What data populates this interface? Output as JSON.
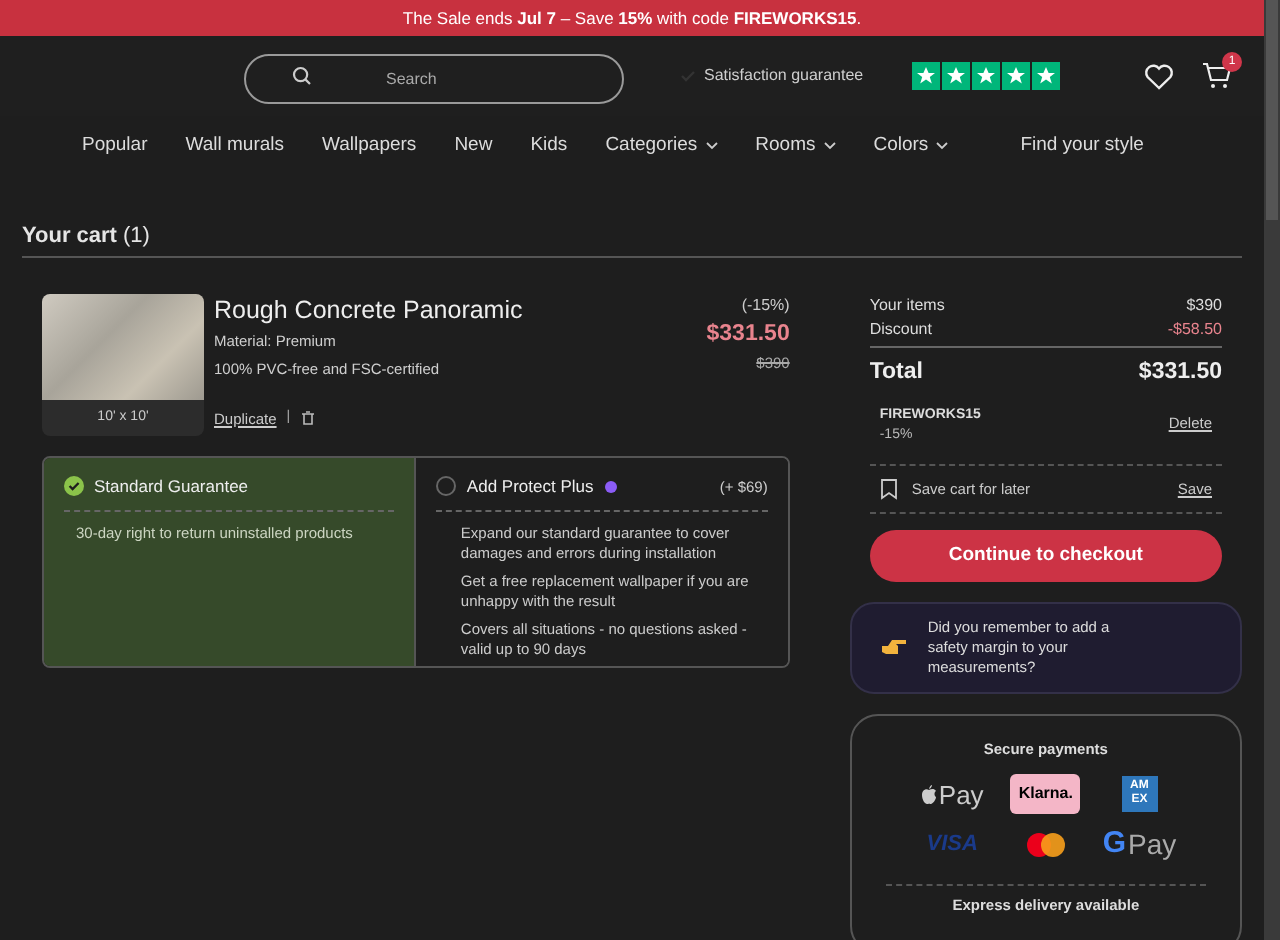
{
  "banner": {
    "text": "The Sale ends **Jul 7** – Save **15%** with code **FIREWORKS15**."
  },
  "header": {
    "search": {
      "placeholder": "Search"
    },
    "guarantee": "Satisfaction guarantee",
    "stars": 5,
    "cart_count": "1"
  },
  "nav": [
    {
      "label": "Popular",
      "dropdown": false
    },
    {
      "label": "Wall murals",
      "dropdown": false
    },
    {
      "label": "Wallpapers",
      "dropdown": false
    },
    {
      "label": "New",
      "dropdown": false
    },
    {
      "label": "Kids",
      "dropdown": false
    },
    {
      "label": "Categories",
      "dropdown": true
    },
    {
      "label": "Rooms",
      "dropdown": true
    },
    {
      "label": "Colors",
      "dropdown": true
    },
    {
      "label": "Find your style",
      "dropdown": false
    }
  ],
  "cart": {
    "title": "Your cart",
    "count": "(1)",
    "item": {
      "name": "Rough Concrete Panoramic",
      "material": "Material: Premium",
      "note": "100% PVC-free and FSC-certified",
      "size": "10' x 10'",
      "duplicate": "Duplicate",
      "separator": "|",
      "discount": "(-15%)",
      "price": "$331.50",
      "old_price": "$390"
    },
    "guarantees": [
      {
        "title": "Standard Guarantee",
        "selected": true,
        "points": [
          "30-day right to return uninstalled products"
        ]
      },
      {
        "title": "Add Protect Plus",
        "selected": false,
        "price": "(+ $69)",
        "points": [
          "Expand our standard guarantee to cover damages and errors during installation",
          "Get a free replacement wallpaper if you are unhappy with the result",
          "Covers all situations - no questions asked - valid up to 90 days"
        ]
      }
    ]
  },
  "summary": {
    "rows": [
      {
        "label": "Your items",
        "value": "$390",
        "kind": "plain"
      },
      {
        "label": "Discount",
        "value": "-$58.50",
        "kind": "discount"
      },
      {
        "label": "Total",
        "value": "$331.50",
        "kind": "total"
      }
    ],
    "code": {
      "name": "FIREWORKS15",
      "percent": "-15%",
      "action": "Delete"
    },
    "save": {
      "label": "Save cart for later",
      "action": "Save"
    },
    "checkout": "Continue to checkout",
    "tip": "Did you remember to add a safety margin to your measurements?",
    "payments": {
      "title": "Secure payments",
      "logos": [
        {
          "kind": "applepay",
          "text": "Pay"
        },
        {
          "kind": "klarna",
          "text": "Klarna."
        },
        {
          "kind": "amex",
          "text": "AM EX"
        },
        {
          "kind": "visa",
          "text": "VISA"
        },
        {
          "kind": "mastercard"
        },
        {
          "kind": "gpay",
          "mark": "G",
          "text": "Pay"
        }
      ],
      "footer": "Express delivery available"
    }
  }
}
